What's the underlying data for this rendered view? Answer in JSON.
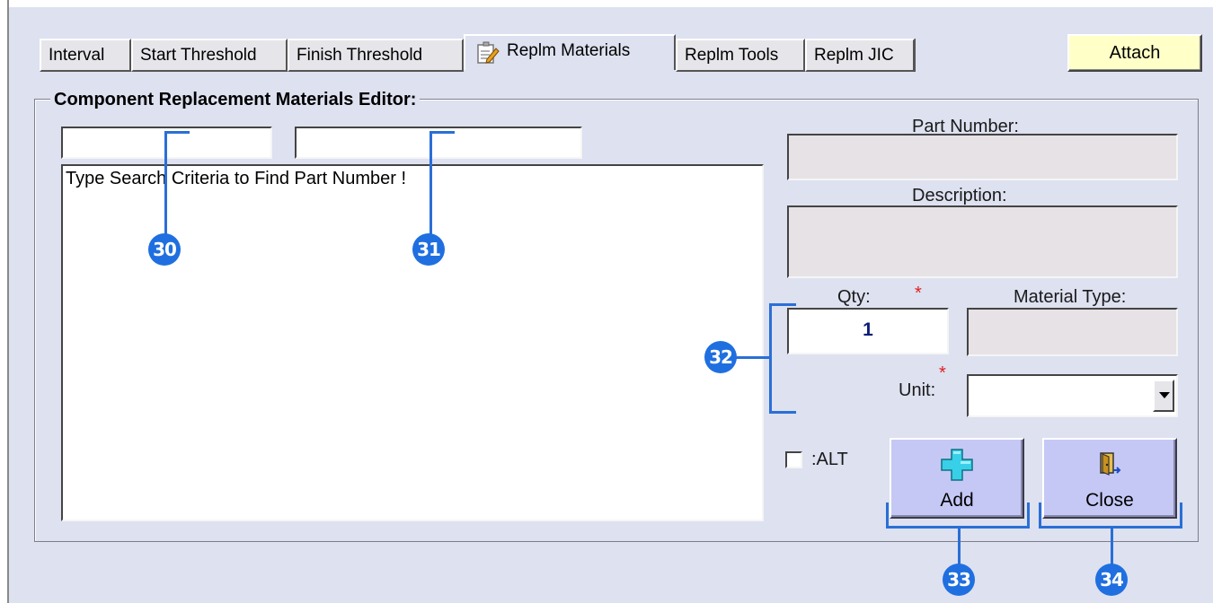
{
  "tabs": [
    {
      "label": "Interval"
    },
    {
      "label": "Start Threshold"
    },
    {
      "label": "Finish Threshold"
    },
    {
      "label": "Replm Materials",
      "active": true,
      "icon": "edit-document-icon"
    },
    {
      "label": "Replm Tools"
    },
    {
      "label": "Replm JIC"
    }
  ],
  "attach": {
    "label": "Attach"
  },
  "editor": {
    "title": "Component Replacement Materials Editor:",
    "search_field_1": "",
    "search_field_2": "",
    "results_text": "Type Search Criteria to Find Part Number !",
    "part_number_label": "Part Number:",
    "part_number_value": "",
    "description_label": "Description:",
    "description_value": "",
    "qty_label": "Qty:",
    "qty_value": "1",
    "required_marker": "*",
    "material_type_label": "Material Type:",
    "material_type_value": "",
    "unit_label": "Unit:",
    "unit_value": "",
    "alt_label": ":ALT",
    "alt_checked": false
  },
  "buttons": {
    "add_label": "Add",
    "close_label": "Close",
    "add_icon": "plus-icon",
    "close_icon": "exit-door-icon"
  },
  "callouts": [
    "30",
    "31",
    "32",
    "33",
    "34"
  ],
  "colors": {
    "background": "#dde1f0",
    "attach_button": "#ffffc8",
    "action_button": "#c5c8f5",
    "callout": "#1f6fe0",
    "required_star": "#e02020",
    "qty_text": "#0c1b7a"
  }
}
